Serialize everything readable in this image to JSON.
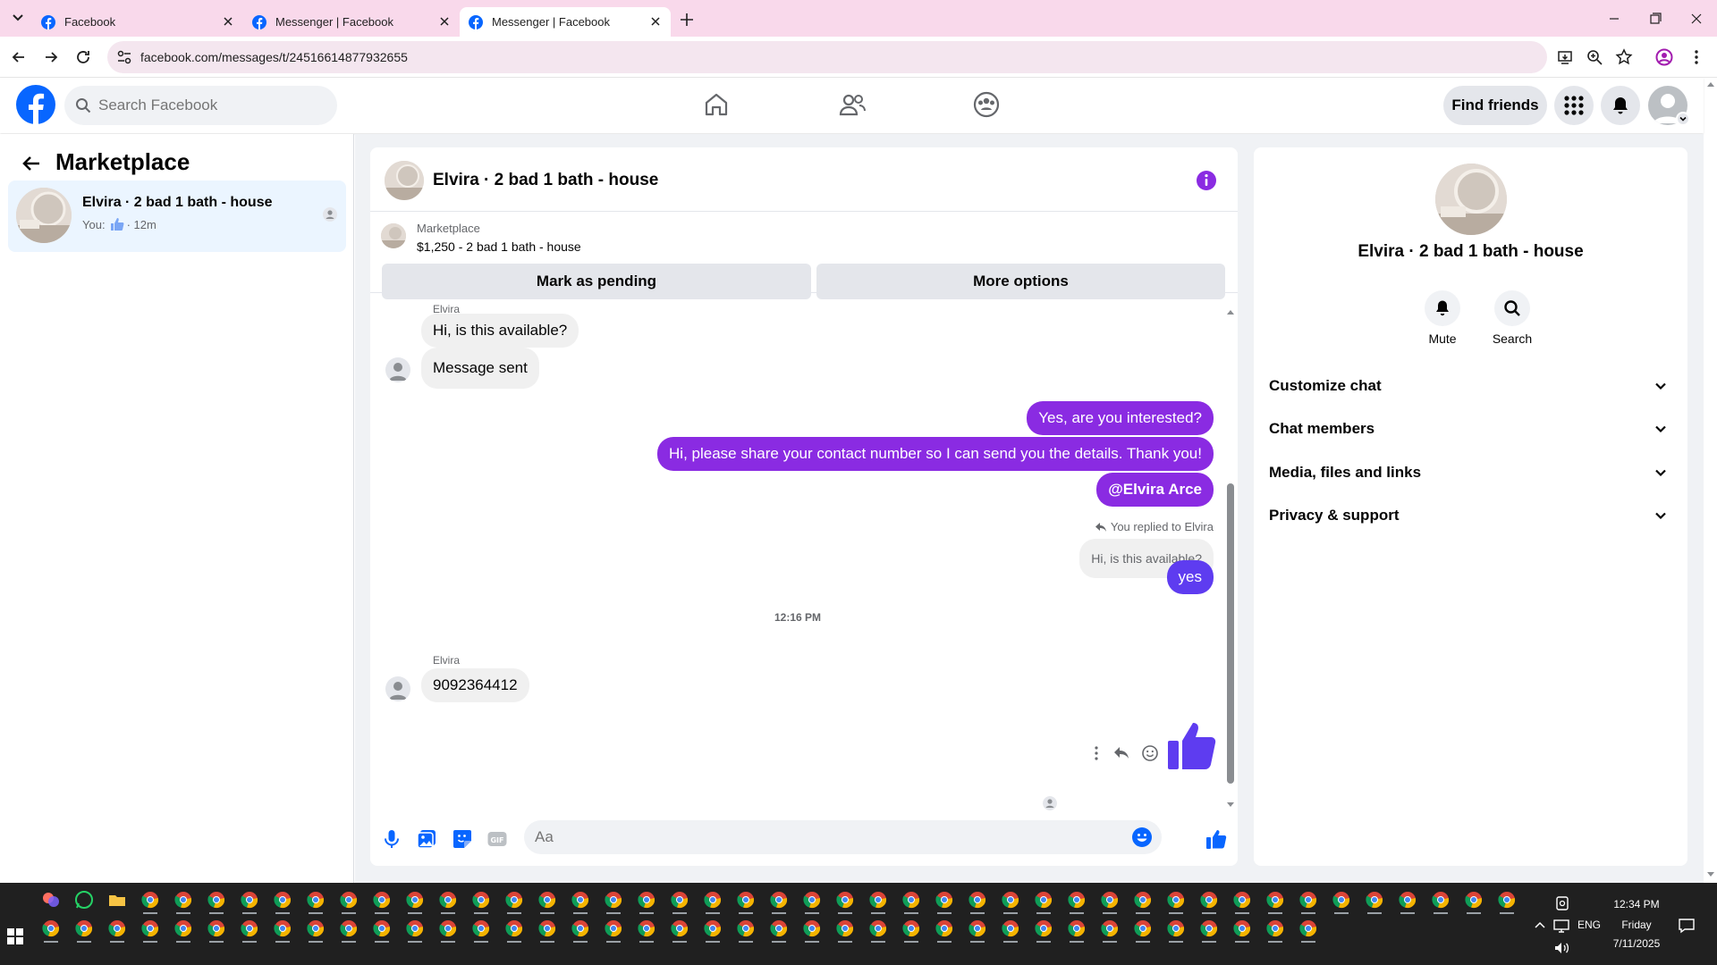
{
  "browser": {
    "tabs": [
      {
        "title": "Facebook"
      },
      {
        "title": "Messenger | Facebook"
      },
      {
        "title": "Messenger | Facebook"
      }
    ],
    "url": "facebook.com/messages/t/24516614877932655"
  },
  "header": {
    "search_placeholder": "Search Facebook",
    "find_friends": "Find friends",
    "accent": "#0866ff"
  },
  "left": {
    "title": "Marketplace",
    "conversation": {
      "name": "Elvira · 2 bad 1 bath - house",
      "you": "You:",
      "time": "· 12m"
    }
  },
  "chat": {
    "title": "Elvira · 2 bad 1 bath - house",
    "marketplace_label": "Marketplace",
    "listing": "$1,250 - 2 bad 1 bath - house",
    "mark_pending": "Mark as pending",
    "more_options": "More options",
    "sender_top": "Elvira",
    "messages_in_1": [
      "Hi, is this available?",
      "Message sent"
    ],
    "messages_out": [
      "Yes, are you interested?",
      "Hi, please share your contact number so I can send you the details. Thank you!",
      "@Elvira Arce"
    ],
    "replied_label": "You replied to Elvira",
    "quoted": "Hi, is this available?",
    "reply_text": "yes",
    "timestamp": "12:16 PM",
    "sender_bottom": "Elvira",
    "message_in_2": "9092364412",
    "composer_placeholder": "Aa",
    "bubble_color": "#8a2be2"
  },
  "right": {
    "name": "Elvira · 2 bad 1 bath - house",
    "actions": [
      {
        "label": "Mute"
      },
      {
        "label": "Search"
      }
    ],
    "sections": [
      "Customize chat",
      "Chat members",
      "Media, files and links",
      "Privacy & support"
    ]
  },
  "taskbar": {
    "time": "12:34 PM",
    "day": "Friday",
    "date": "7/11/2025",
    "lang": "ENG"
  }
}
